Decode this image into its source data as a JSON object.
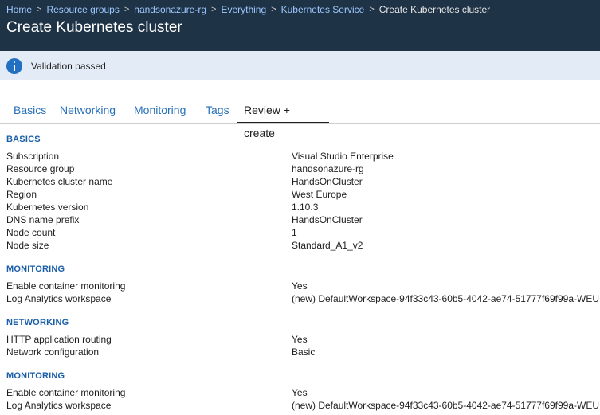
{
  "breadcrumb": {
    "items": [
      "Home",
      "Resource groups",
      "handsonazure-rg",
      "Everything",
      "Kubernetes Service",
      "Create Kubernetes cluster"
    ]
  },
  "page": {
    "title": "Create Kubernetes cluster"
  },
  "banner": {
    "text": "Validation passed",
    "icon": "info-icon"
  },
  "tabs": [
    "Basics",
    "Networking",
    "Monitoring",
    "Tags",
    "Review + create"
  ],
  "active_tab": "Review + create",
  "sections": {
    "basics": {
      "title": "BASICS",
      "rows": [
        {
          "label": "Subscription",
          "value": "Visual Studio Enterprise"
        },
        {
          "label": "Resource group",
          "value": "handsonazure-rg"
        },
        {
          "label": "Kubernetes cluster name",
          "value": "HandsOnCluster"
        },
        {
          "label": "Region",
          "value": "West Europe"
        },
        {
          "label": "Kubernetes version",
          "value": "1.10.3"
        },
        {
          "label": "DNS name prefix",
          "value": "HandsOnCluster"
        },
        {
          "label": "Node count",
          "value": "1"
        },
        {
          "label": "Node size",
          "value": "Standard_A1_v2"
        }
      ]
    },
    "monitoring": {
      "title": "MONITORING",
      "rows": [
        {
          "label": "Enable container monitoring",
          "value": "Yes"
        },
        {
          "label": "Log Analytics workspace",
          "value": "(new) DefaultWorkspace-94f33c43-60b5-4042-ae74-51777f69f99a-WEU"
        }
      ]
    },
    "networking": {
      "title": "NETWORKING",
      "rows": [
        {
          "label": "HTTP application routing",
          "value": "Yes"
        },
        {
          "label": "Network configuration",
          "value": "Basic"
        }
      ]
    },
    "monitoring2": {
      "title": "MONITORING",
      "rows": [
        {
          "label": "Enable container monitoring",
          "value": "Yes"
        },
        {
          "label": "Log Analytics workspace",
          "value": "(new) DefaultWorkspace-94f33c43-60b5-4042-ae74-51777f69f99a-WEU"
        }
      ]
    }
  },
  "colors": {
    "header_bg": "#1f3346",
    "banner_bg": "#e3ecf6",
    "link": "#2870b8",
    "section_title": "#1b5fa8"
  }
}
